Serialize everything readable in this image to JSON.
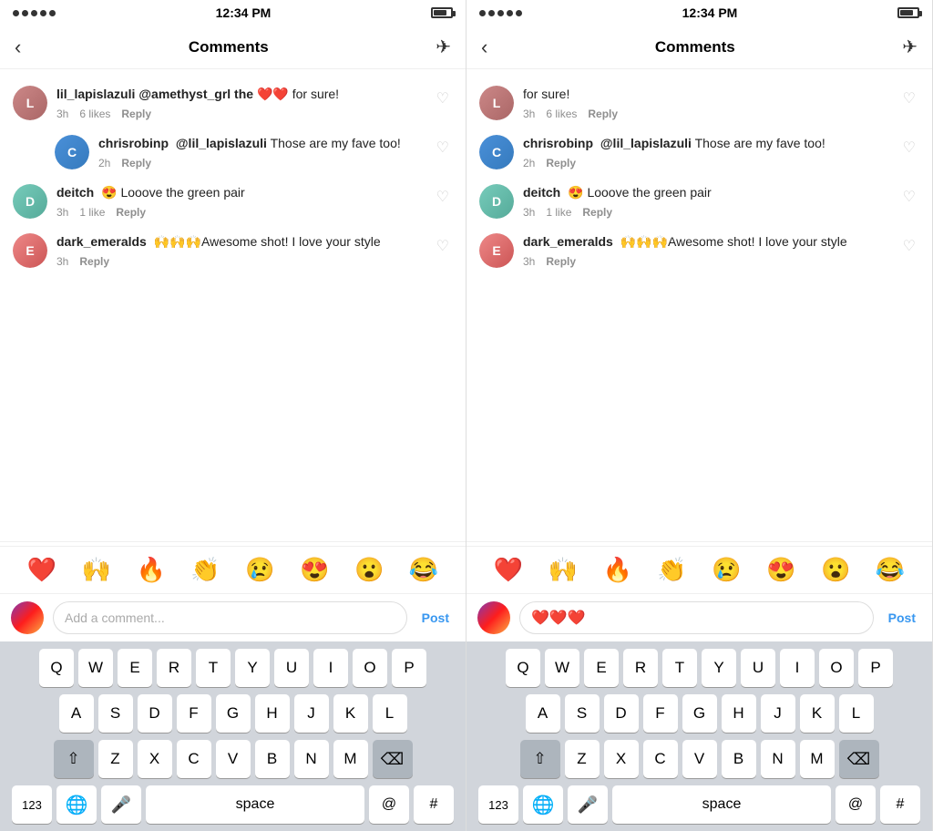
{
  "panels": [
    {
      "id": "left",
      "statusBar": {
        "dots": 5,
        "time": "12:34 PM"
      },
      "header": {
        "back": "‹",
        "title": "Comments",
        "send": "✈"
      },
      "comments": [
        {
          "id": "c1",
          "avatar_color": "#c8a",
          "avatar_text": "L",
          "username": "lil_lapislazuli",
          "mention": "@amethyst_grl the ❤️❤️",
          "text_suffix": " for sure!",
          "time": "3h",
          "likes": "6 likes",
          "reply": "Reply",
          "indented": false
        },
        {
          "id": "c2",
          "avatar_color": "#4a90d9",
          "avatar_text": "C",
          "username": "chrisrobinp",
          "mention": "@lil_lapislazuli",
          "text_suffix": " Those are my fave too!",
          "time": "2h",
          "likes": "",
          "reply": "Reply",
          "indented": true
        },
        {
          "id": "c3",
          "avatar_color": "#7cb",
          "avatar_text": "D",
          "username": "deitch",
          "mention": "",
          "text_prefix": "😍 Looove the green pair",
          "time": "3h",
          "likes": "1 like",
          "reply": "Reply",
          "indented": false
        },
        {
          "id": "c4",
          "avatar_color": "#e88",
          "avatar_text": "E",
          "username": "dark_emeralds",
          "mention": "",
          "text_prefix": "🙌🙌🙌Awesome shot! I love your style",
          "time": "3h",
          "likes": "",
          "reply": "Reply",
          "indented": false
        }
      ],
      "emojis": [
        "❤️",
        "🙌",
        "🔥",
        "👏",
        "😢",
        "😍",
        "😮",
        "😂"
      ],
      "inputPlaceholder": "Add a comment...",
      "postLabel": "Post",
      "inputHasHearts": false,
      "keyboard": {
        "rows": [
          [
            "Q",
            "W",
            "E",
            "R",
            "T",
            "Y",
            "U",
            "I",
            "O",
            "P"
          ],
          [
            "A",
            "S",
            "D",
            "F",
            "G",
            "H",
            "J",
            "K",
            "L"
          ],
          [
            "Z",
            "X",
            "C",
            "V",
            "B",
            "N",
            "M"
          ]
        ],
        "showBottom": true
      }
    },
    {
      "id": "right",
      "statusBar": {
        "dots": 5,
        "time": "12:34 PM"
      },
      "header": {
        "back": "‹",
        "title": "Comments",
        "send": "✈"
      },
      "comments": [
        {
          "id": "r1",
          "avatar_color": "#c8a",
          "avatar_text": "L",
          "username": "",
          "mention": "",
          "text_prefix": "for sure!",
          "time": "3h",
          "likes": "6 likes",
          "reply": "Reply",
          "indented": false
        },
        {
          "id": "r2",
          "avatar_color": "#4a90d9",
          "avatar_text": "C",
          "username": "chrisrobinp",
          "mention": "@lil_lapislazuli",
          "text_suffix": " Those are my fave too!",
          "time": "2h",
          "likes": "",
          "reply": "Reply",
          "indented": false
        },
        {
          "id": "r3",
          "avatar_color": "#7cb",
          "avatar_text": "D",
          "username": "deitch",
          "mention": "",
          "text_prefix": "😍 Looove the green pair",
          "time": "3h",
          "likes": "1 like",
          "reply": "Reply",
          "indented": false
        },
        {
          "id": "r4",
          "avatar_color": "#e88",
          "avatar_text": "E",
          "username": "dark_emeralds",
          "mention": "",
          "text_prefix": "🙌🙌🙌Awesome shot! I love your style",
          "time": "3h",
          "likes": "",
          "reply": "Reply",
          "indented": false
        }
      ],
      "emojis": [
        "❤️",
        "🙌",
        "🔥",
        "👏",
        "😢",
        "😍",
        "😮",
        "😂"
      ],
      "inputPlaceholder": "",
      "postLabel": "Post",
      "inputHasHearts": true,
      "inputHeartsText": "❤️❤️❤️",
      "keyboard": {
        "rows": [
          [
            "Q",
            "W",
            "E",
            "R",
            "T",
            "Y",
            "U",
            "I",
            "O",
            "P"
          ],
          [
            "A",
            "S",
            "D",
            "F",
            "G",
            "H",
            "J",
            "K",
            "L"
          ],
          [
            "Z",
            "X",
            "C",
            "V",
            "B",
            "N",
            "M"
          ]
        ],
        "showBottom": true
      }
    }
  ]
}
